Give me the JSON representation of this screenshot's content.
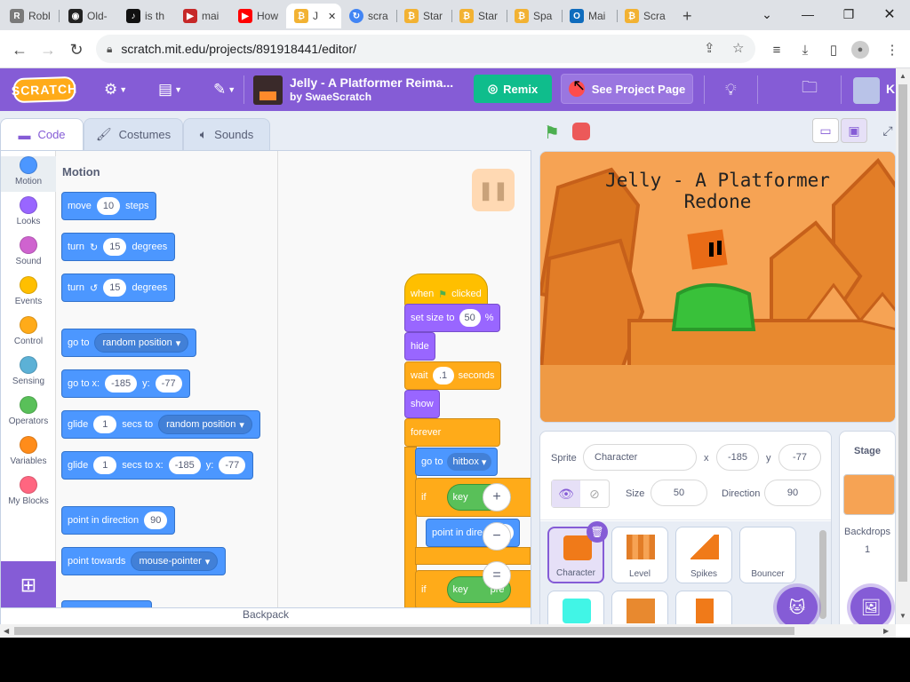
{
  "browser": {
    "tabs": [
      {
        "label": "Robl",
        "color": "#7a7a7a",
        "glyph": "R"
      },
      {
        "label": "Old-",
        "color": "#222222",
        "glyph": "◉"
      },
      {
        "label": "is th",
        "color": "#111111",
        "glyph": "♪"
      },
      {
        "label": "mai",
        "color": "#c62828",
        "glyph": "▶"
      },
      {
        "label": "How",
        "color": "#ff0000",
        "glyph": "▶"
      },
      {
        "label": "J",
        "color": "#f2b233",
        "glyph": "₿",
        "active": true
      },
      {
        "label": "scra",
        "color": "#4285f4",
        "glyph": "↻"
      },
      {
        "label": "Star",
        "color": "#f2b233",
        "glyph": "₿"
      },
      {
        "label": "Star",
        "color": "#f2b233",
        "glyph": "₿"
      },
      {
        "label": "Spa",
        "color": "#f2b233",
        "glyph": "₿"
      },
      {
        "label": "Mai",
        "color": "#0f6cbd",
        "glyph": "O"
      },
      {
        "label": "Scra",
        "color": "#f2b233",
        "glyph": "₿"
      }
    ],
    "new_tab": "+",
    "url": "scratch.mit.edu/projects/891918441/editor/"
  },
  "header": {
    "logo": "SCRATCH",
    "project_title": "Jelly - A Platformer Reima...",
    "project_by": "by SwaeScratch",
    "remix": "Remix",
    "see_project_page": "See Project Page",
    "user_initial": "K"
  },
  "tabs": {
    "code": "Code",
    "costumes": "Costumes",
    "sounds": "Sounds"
  },
  "categories": [
    {
      "name": "Motion",
      "color": "#4c97ff"
    },
    {
      "name": "Looks",
      "color": "#9966ff"
    },
    {
      "name": "Sound",
      "color": "#cf63cf"
    },
    {
      "name": "Events",
      "color": "#ffbf00"
    },
    {
      "name": "Control",
      "color": "#ffab19"
    },
    {
      "name": "Sensing",
      "color": "#5cb1d6"
    },
    {
      "name": "Operators",
      "color": "#59c059"
    },
    {
      "name": "Variables",
      "color": "#ff8c1a"
    },
    {
      "name": "My Blocks",
      "color": "#ff6680"
    }
  ],
  "palette": {
    "title": "Motion",
    "move": {
      "a": "move",
      "v": "10",
      "b": "steps"
    },
    "turn_cw": {
      "a": "turn",
      "v": "15",
      "b": "degrees"
    },
    "turn_ccw": {
      "a": "turn",
      "v": "15",
      "b": "degrees"
    },
    "goto": {
      "a": "go to",
      "dd": "random position"
    },
    "gotoxy": {
      "a": "go to x:",
      "x": "-185",
      "b": "y:",
      "y": "-77"
    },
    "glide": {
      "a": "glide",
      "v": "1",
      "b": "secs to",
      "dd": "random position"
    },
    "glidexy": {
      "a": "glide",
      "v": "1",
      "b": "secs to x:",
      "x": "-185",
      "c": "y:",
      "y": "-77"
    },
    "point": {
      "a": "point in direction",
      "v": "90"
    },
    "towards": {
      "a": "point towards",
      "dd": "mouse-pointer"
    }
  },
  "script": {
    "when": "when",
    "clicked": "clicked",
    "setsize": {
      "a": "set size to",
      "v": "50",
      "b": "%"
    },
    "hide": "hide",
    "wait": {
      "a": "wait",
      "v": ".1",
      "b": "seconds"
    },
    "show": "show",
    "forever": "forever",
    "goto": {
      "a": "go to",
      "dd": "hitbox"
    },
    "if1": "if",
    "key1": "key",
    "pre1": "pre",
    "pointdir": {
      "a": "point in direc",
      "v": "90"
    },
    "if2": "if",
    "key2": "key",
    "pre2": "pre"
  },
  "zoom": {
    "in": "+",
    "out": "−",
    "reset": "="
  },
  "backpack": "Backpack",
  "stage": {
    "title_line1": "Jelly - A Platformer",
    "title_line2": "Redone"
  },
  "sprite_info": {
    "sprite_label": "Sprite",
    "sprite_name": "Character",
    "x_label": "x",
    "x": "-185",
    "y_label": "y",
    "y": "-77",
    "size_label": "Size",
    "size": "50",
    "direction_label": "Direction",
    "direction": "90"
  },
  "sprites": [
    "Character",
    "Level",
    "Spikes",
    "Bouncer"
  ],
  "stage_pane": {
    "label": "Stage",
    "backdrops_label": "Backdrops",
    "backdrops_count": "1"
  }
}
